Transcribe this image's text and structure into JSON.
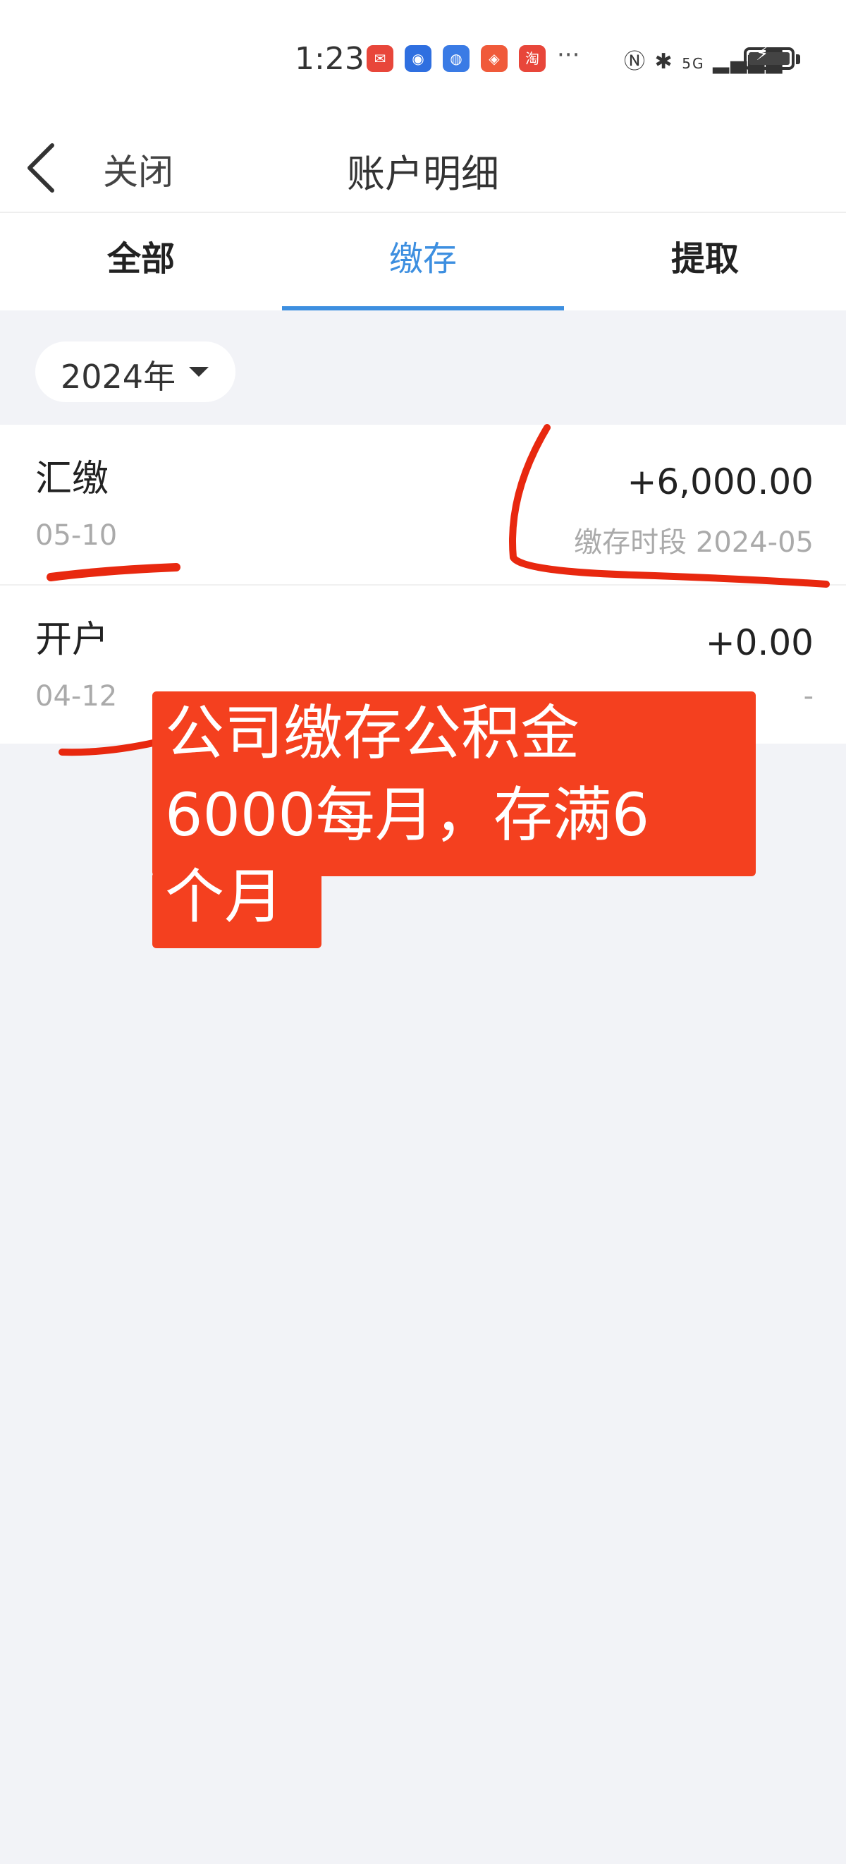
{
  "status_bar": {
    "time": "1:23",
    "dots": "···",
    "network": "5G",
    "icons": [
      "nfc-icon",
      "bluetooth-icon",
      "signal-icon",
      "battery-icon"
    ],
    "app_icons": [
      {
        "name": "red-packet-app-icon",
        "color": "#e8463a"
      },
      {
        "name": "blue-app-icon-1",
        "color": "#2f6fe0"
      },
      {
        "name": "blue-app-icon-2",
        "color": "#3a7be5"
      },
      {
        "name": "orange-app-icon",
        "color": "#f05a3a"
      },
      {
        "name": "taobao-app-icon",
        "color": "#e8463a",
        "glyph": "淘"
      }
    ]
  },
  "nav": {
    "back_icon": "chevron-left-icon",
    "close_label": "关闭",
    "title": "账户明细"
  },
  "tabs": [
    {
      "label": "全部",
      "active": false
    },
    {
      "label": "缴存",
      "active": true
    },
    {
      "label": "提取",
      "active": false
    }
  ],
  "filter": {
    "year": "2024年",
    "caret_icon": "caret-down-icon"
  },
  "records": [
    {
      "type": "汇缴",
      "date": "05-10",
      "amount": "+6,000.00",
      "period": "缴存时段 2024-05"
    },
    {
      "type": "开户",
      "date": "04-12",
      "amount": "+0.00",
      "period": "-"
    }
  ],
  "annotation": {
    "lines": [
      "公司缴存公积金",
      "6000每月，存满6",
      "个月"
    ],
    "color": "#f4401f"
  },
  "colors": {
    "accent": "#3d8fe0",
    "background": "#f2f3f7",
    "marker": "#e8280f"
  }
}
